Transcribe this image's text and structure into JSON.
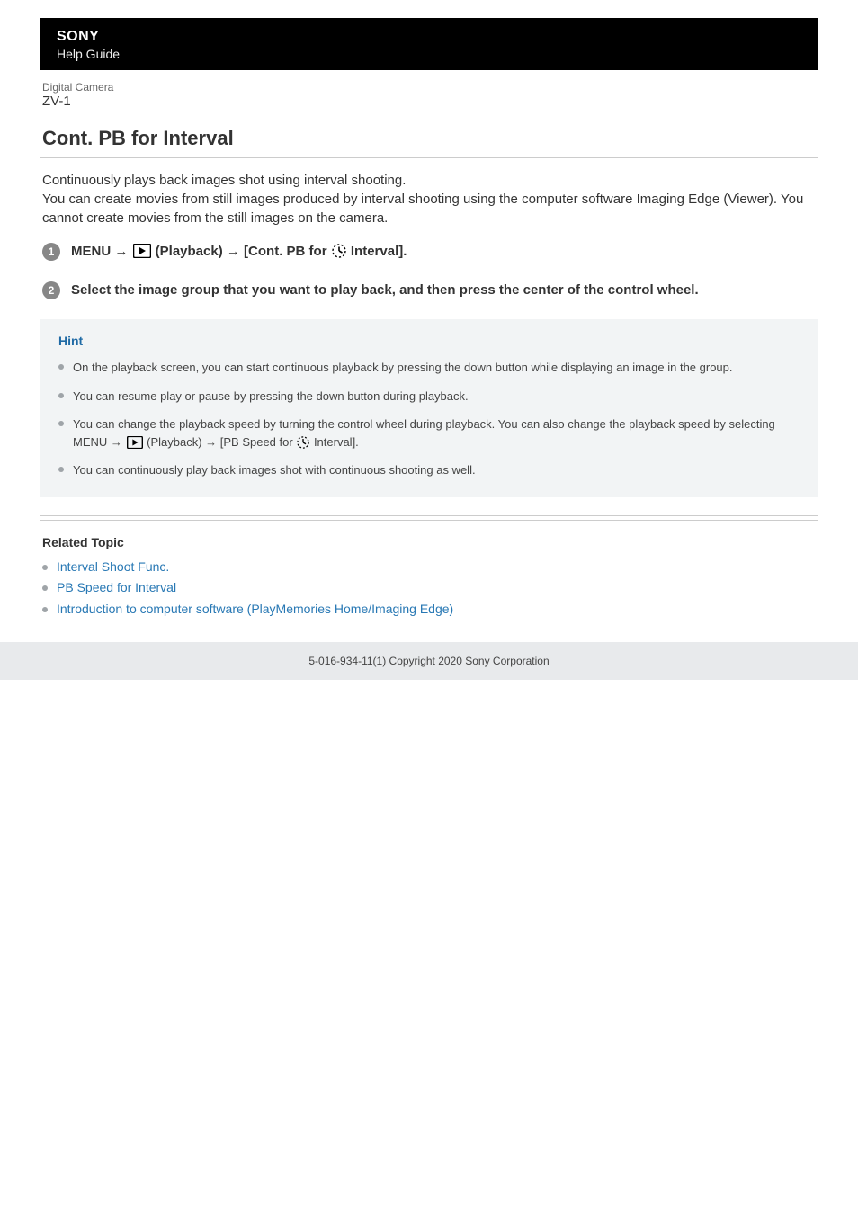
{
  "header": {
    "brand": "SONY",
    "guide_label": "Help Guide",
    "product_label": "Digital Camera",
    "product_model": "ZV-1"
  },
  "page": {
    "title": "Cont. PB for Interval",
    "intro_line1": "Continuously plays back images shot using interval shooting.",
    "intro_line2": "You can create movies from still images produced by interval shooting using the computer software Imaging Edge (Viewer). You cannot create movies from the still images on the camera."
  },
  "steps": [
    {
      "num": "1",
      "prefix": "MENU → ",
      "after_icon1": "(Playback) → [Cont. PB for ",
      "after_icon2": " Interval]."
    },
    {
      "num": "2",
      "text": "Select the image group that you want to play back, and then press the center of the control wheel."
    }
  ],
  "hint": {
    "title": "Hint",
    "items": [
      "On the playback screen, you can start continuous playback by pressing the down button while displaying an image in the group.",
      "You can resume play or pause by pressing the down button during playback.",
      {
        "pre": "You can change the playback speed by turning the control wheel during playback. You can also change the playback speed by selecting MENU → ",
        "mid": "(Playback) → [PB Speed for ",
        "post": "Interval]."
      },
      "You can continuously play back images shot with continuous shooting as well."
    ]
  },
  "related": {
    "title": "Related Topic",
    "links": [
      "Interval Shoot Func.",
      "PB Speed for Interval",
      "Introduction to computer software (PlayMemories Home/Imaging Edge)"
    ]
  },
  "footer": "5-016-934-11(1) Copyright 2020 Sony Corporation"
}
